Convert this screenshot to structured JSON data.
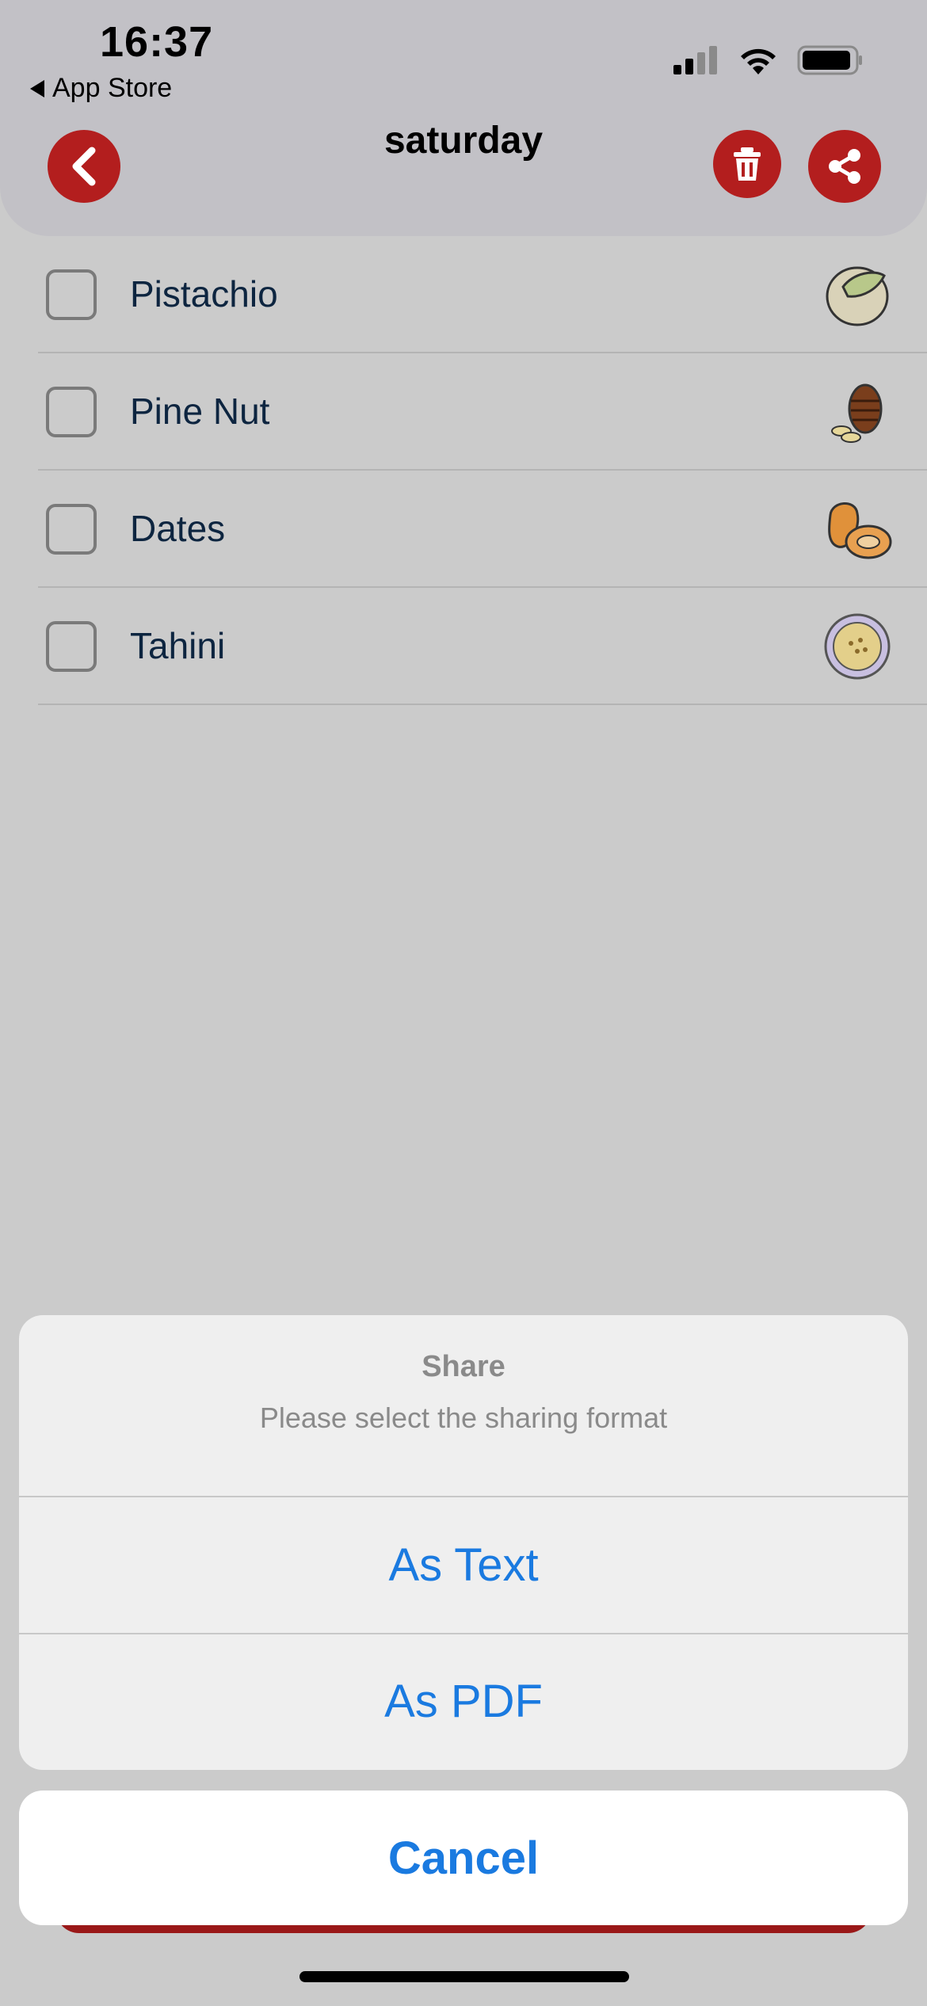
{
  "status_bar": {
    "time": "16:37",
    "back_app": "App Store"
  },
  "header": {
    "title": "saturday"
  },
  "items": [
    {
      "label": "Pistachio",
      "icon": "pistachio-icon"
    },
    {
      "label": "Pine Nut",
      "icon": "pine-nut-icon"
    },
    {
      "label": "Dates",
      "icon": "dates-icon"
    },
    {
      "label": "Tahini",
      "icon": "tahini-icon"
    }
  ],
  "share_sheet": {
    "title": "Share",
    "message": "Please select the sharing format",
    "options": [
      "As Text",
      "As PDF"
    ],
    "cancel": "Cancel"
  },
  "colors": {
    "accent_red": "#b31e1e",
    "ios_blue": "#1a7ae0"
  }
}
